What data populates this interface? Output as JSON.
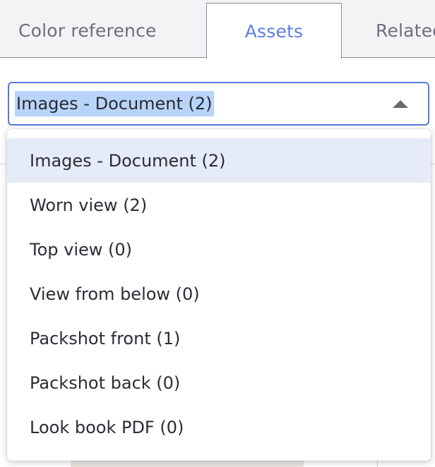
{
  "tabs": [
    {
      "label": "Color reference",
      "active": false
    },
    {
      "label": "Assets",
      "active": true
    },
    {
      "label": "Related",
      "active": false
    }
  ],
  "select": {
    "value": "Images - Document (2)",
    "options": [
      "Images - Document (2)",
      "Worn view (2)",
      "Top view (0)",
      "View from below (0)",
      "Packshot front (1)",
      "Packshot back (0)",
      "Look book PDF (0)"
    ],
    "selected_index": 0
  },
  "colors": {
    "accent": "#5e7fe0",
    "select_border": "#5b78d9",
    "text_highlight": "#b8d4f8",
    "selected_option_bg": "#e6ebf8"
  },
  "icons": {
    "select_arrow": "caret-up-icon"
  }
}
